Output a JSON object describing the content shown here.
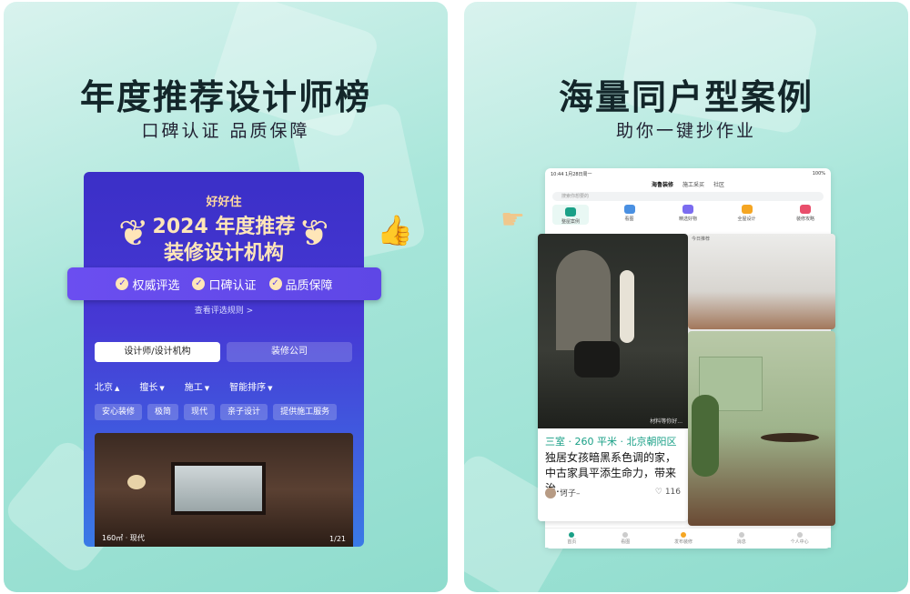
{
  "left": {
    "headline": "年度推荐设计师榜",
    "subline": "口碑认证 品质保障",
    "brand": "好好住",
    "award_line1": "2024 年度推荐",
    "award_line2": "装修设计机构",
    "badges": [
      "权威评选",
      "口碑认证",
      "品质保障"
    ],
    "rules_link": "查看评选规则 >",
    "segments": [
      "设计师/设计机构",
      "装修公司"
    ],
    "filters": [
      "北京",
      "擅长",
      "施工",
      "智能排序"
    ],
    "tags": [
      "安心装修",
      "极简",
      "现代",
      "亲子设计",
      "提供施工服务"
    ],
    "photo_caption": "160㎡ · 现代",
    "photo_index": "1/21"
  },
  "right": {
    "headline": "海量同户型案例",
    "subline": "助你一键抄作业",
    "status_time": "10:44",
    "status_date": "1月28日周一",
    "status_battery": "100%",
    "top_nav": [
      "海鲁装修",
      "施工采买",
      "社区"
    ],
    "search_placeholder": "搜索你想要的",
    "categories": [
      "整屋案例",
      "看图",
      "精选好物",
      "全屋设计",
      "装修攻略"
    ],
    "card": {
      "location": "三室 · 260 平米 · 北京朝阳区",
      "title": "独居女孩暗黑系色调的家，中古家具平添生命力，带来治...",
      "user": "诃子–",
      "likes": "116",
      "image_caption": "材料等你好..."
    },
    "right_image_caption": "今日推荐",
    "tabbar": [
      "首页",
      "看图",
      "发布装修",
      "消息",
      "个人中心"
    ]
  },
  "colors": {
    "panel_bg": "#a8e6da",
    "card_purple": "#4638d4",
    "accent_green": "#1aa087",
    "gold": "#ffe6b8"
  }
}
